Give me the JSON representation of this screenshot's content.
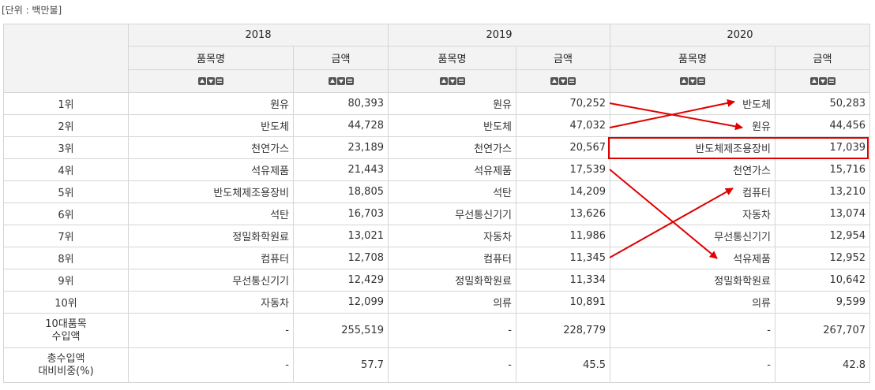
{
  "unit_label": "[단위 : 백만불]",
  "years": [
    "2018",
    "2019",
    "2020"
  ],
  "col_item": "품목명",
  "col_amount": "금액",
  "rows": [
    {
      "rank": "1위",
      "y2018_item": "원유",
      "y2018_amt": "80,393",
      "y2019_item": "원유",
      "y2019_amt": "70,252",
      "y2020_item": "반도체",
      "y2020_amt": "50,283"
    },
    {
      "rank": "2위",
      "y2018_item": "반도체",
      "y2018_amt": "44,728",
      "y2019_item": "반도체",
      "y2019_amt": "47,032",
      "y2020_item": "원유",
      "y2020_amt": "44,456"
    },
    {
      "rank": "3위",
      "y2018_item": "천연가스",
      "y2018_amt": "23,189",
      "y2019_item": "천연가스",
      "y2019_amt": "20,567",
      "y2020_item": "반도체제조용장비",
      "y2020_amt": "17,039"
    },
    {
      "rank": "4위",
      "y2018_item": "석유제품",
      "y2018_amt": "21,443",
      "y2019_item": "석유제품",
      "y2019_amt": "17,539",
      "y2020_item": "천연가스",
      "y2020_amt": "15,716"
    },
    {
      "rank": "5위",
      "y2018_item": "반도체제조용장비",
      "y2018_amt": "18,805",
      "y2019_item": "석탄",
      "y2019_amt": "14,209",
      "y2020_item": "컴퓨터",
      "y2020_amt": "13,210"
    },
    {
      "rank": "6위",
      "y2018_item": "석탄",
      "y2018_amt": "16,703",
      "y2019_item": "무선통신기기",
      "y2019_amt": "13,626",
      "y2020_item": "자동차",
      "y2020_amt": "13,074"
    },
    {
      "rank": "7위",
      "y2018_item": "정밀화학원료",
      "y2018_amt": "13,021",
      "y2019_item": "자동차",
      "y2019_amt": "11,986",
      "y2020_item": "무선통신기기",
      "y2020_amt": "12,954"
    },
    {
      "rank": "8위",
      "y2018_item": "컴퓨터",
      "y2018_amt": "12,708",
      "y2019_item": "컴퓨터",
      "y2019_amt": "11,345",
      "y2020_item": "석유제품",
      "y2020_amt": "12,952"
    },
    {
      "rank": "9위",
      "y2018_item": "무선통신기기",
      "y2018_amt": "12,429",
      "y2019_item": "정밀화학원료",
      "y2019_amt": "11,334",
      "y2020_item": "정밀화학원료",
      "y2020_amt": "10,642"
    },
    {
      "rank": "10위",
      "y2018_item": "자동차",
      "y2018_amt": "12,099",
      "y2019_item": "의류",
      "y2019_amt": "10,891",
      "y2020_item": "의류",
      "y2020_amt": "9,599"
    }
  ],
  "summary_rows": [
    {
      "label_l1": "10대품목",
      "label_l2": "수입액",
      "y2018_item": "-",
      "y2018_amt": "255,519",
      "y2019_item": "-",
      "y2019_amt": "228,779",
      "y2020_item": "-",
      "y2020_amt": "267,707"
    },
    {
      "label_l1": "총수입액",
      "label_l2": "대비비중(%)",
      "y2018_item": "-",
      "y2018_amt": "57.7",
      "y2019_item": "-",
      "y2019_amt": "45.5",
      "y2020_item": "-",
      "y2020_amt": "42.8"
    }
  ],
  "highlight_color": "#e00000"
}
